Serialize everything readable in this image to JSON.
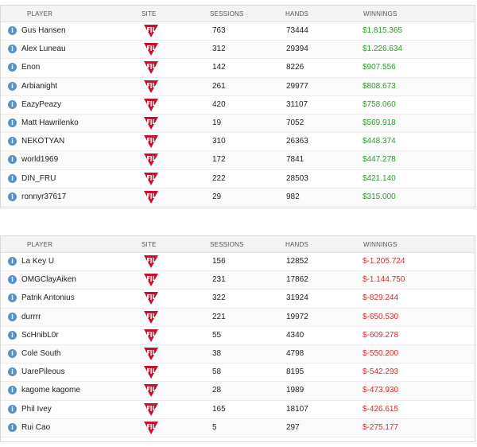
{
  "tables": [
    {
      "headers": {
        "player": "PLAYER",
        "site": "SITE",
        "sessions": "SESSIONS",
        "hands": "HANDS",
        "winnings": "WINNINGS"
      },
      "rows": [
        {
          "player": "Gus Hansen",
          "sessions": "763",
          "hands": "73444",
          "winnings": "$1.815.365"
        },
        {
          "player": "Alex Luneau",
          "sessions": "312",
          "hands": "29394",
          "winnings": "$1.226.634"
        },
        {
          "player": "Enon",
          "sessions": "142",
          "hands": "8226",
          "winnings": "$907.556"
        },
        {
          "player": "Arbianight",
          "sessions": "261",
          "hands": "29977",
          "winnings": "$808.673"
        },
        {
          "player": "EazyPeazy",
          "sessions": "420",
          "hands": "31107",
          "winnings": "$758.060"
        },
        {
          "player": "Matt Hawrilenko",
          "sessions": "19",
          "hands": "7052",
          "winnings": "$569.918"
        },
        {
          "player": "NEKOTYAN",
          "sessions": "310",
          "hands": "26363",
          "winnings": "$448.374"
        },
        {
          "player": "world1969",
          "sessions": "172",
          "hands": "7841",
          "winnings": "$447.278"
        },
        {
          "player": "DIN_FRU",
          "sessions": "222",
          "hands": "28503",
          "winnings": "$421.140"
        },
        {
          "player": "ronnyr37617",
          "sessions": "29",
          "hands": "982",
          "winnings": "$315.000"
        }
      ]
    },
    {
      "headers": {
        "player": "PLAYER",
        "site": "SITE",
        "sessions": "SESSIONS",
        "hands": "HANDS",
        "winnings": "WINNINGS"
      },
      "rows": [
        {
          "player": "La Key U",
          "sessions": "156",
          "hands": "12852",
          "winnings": "$-1.205.724"
        },
        {
          "player": "OMGClayAiken",
          "sessions": "231",
          "hands": "17862",
          "winnings": "$-1.144.750"
        },
        {
          "player": "Patrik Antonius",
          "sessions": "322",
          "hands": "31924",
          "winnings": "$-829.244"
        },
        {
          "player": "durrrr",
          "sessions": "221",
          "hands": "19972",
          "winnings": "$-650.530"
        },
        {
          "player": "ScHnibL0r",
          "sessions": "55",
          "hands": "4340",
          "winnings": "$-609.278"
        },
        {
          "player": "Cole South",
          "sessions": "38",
          "hands": "4798",
          "winnings": "$-550.200"
        },
        {
          "player": "UarePileous",
          "sessions": "58",
          "hands": "8195",
          "winnings": "$-542.293"
        },
        {
          "player": "kagome kagome",
          "sessions": "28",
          "hands": "1989",
          "winnings": "$-473.930"
        },
        {
          "player": "Phil Ivey",
          "sessions": "165",
          "hands": "18107",
          "winnings": "$-426.615"
        },
        {
          "player": "Rui Cao",
          "sessions": "5",
          "hands": "297",
          "winnings": "$-275.177"
        }
      ]
    }
  ],
  "icons": {
    "info": "info-icon",
    "site": "full-tilt-logo-icon"
  },
  "colors": {
    "positive": "#2a9d2a",
    "negative": "#d62b2b",
    "site_logo": "#c8102e",
    "info": "#5f8fc2"
  }
}
